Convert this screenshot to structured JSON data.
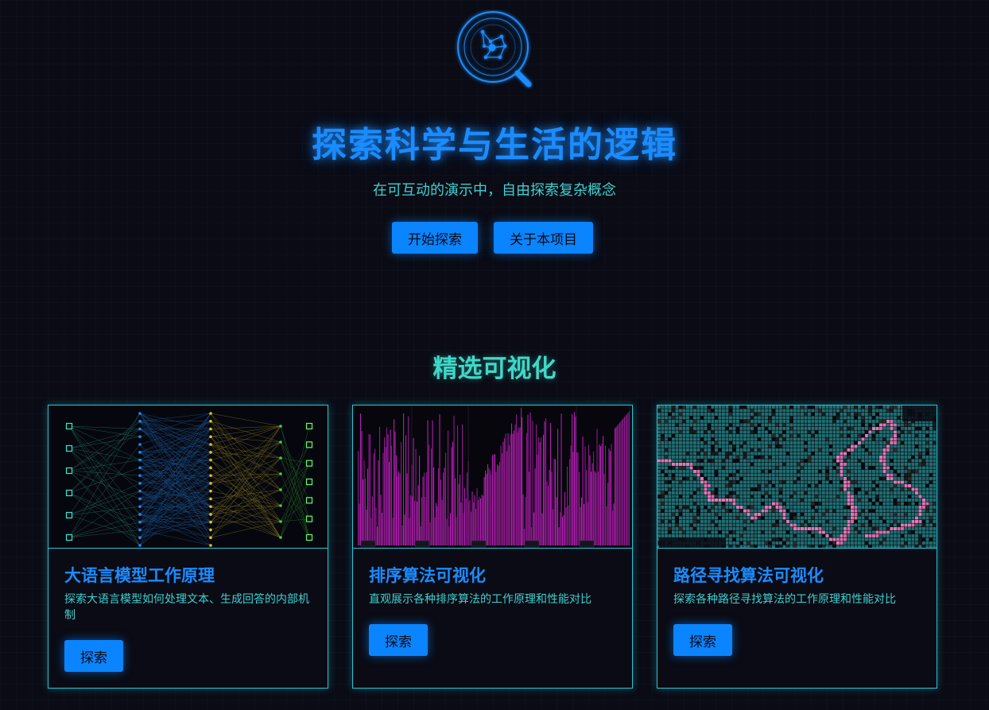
{
  "hero": {
    "logo_icon": "magnifier-network-icon",
    "title": "探索科学与生活的逻辑",
    "subtitle": "在可互动的演示中，自由探索复杂概念",
    "buttons": {
      "start": "开始探索",
      "about": "关于本项目"
    }
  },
  "featured": {
    "title": "精选可视化",
    "cards": [
      {
        "title": "大语言模型工作原理",
        "description": "探索大语言模型如何处理文本、生成回答的内部机制",
        "button": "探索",
        "thumbnail": "neural-network-thumbnail"
      },
      {
        "title": "排序算法可视化",
        "description": "直观展示各种排序算法的工作原理和性能对比",
        "button": "探索",
        "thumbnail": "sorting-bars-thumbnail"
      },
      {
        "title": "路径寻找算法可视化",
        "description": "探索各种路径寻找算法的工作原理和性能对比",
        "button": "探索",
        "thumbnail": "pathfinding-grid-thumbnail"
      }
    ]
  },
  "colors": {
    "background": "#0a0b14",
    "accent_blue": "#0a84ff",
    "title_blue": "#1b8cff",
    "teal": "#3fd0d0",
    "card_border": "#27c6d8"
  }
}
